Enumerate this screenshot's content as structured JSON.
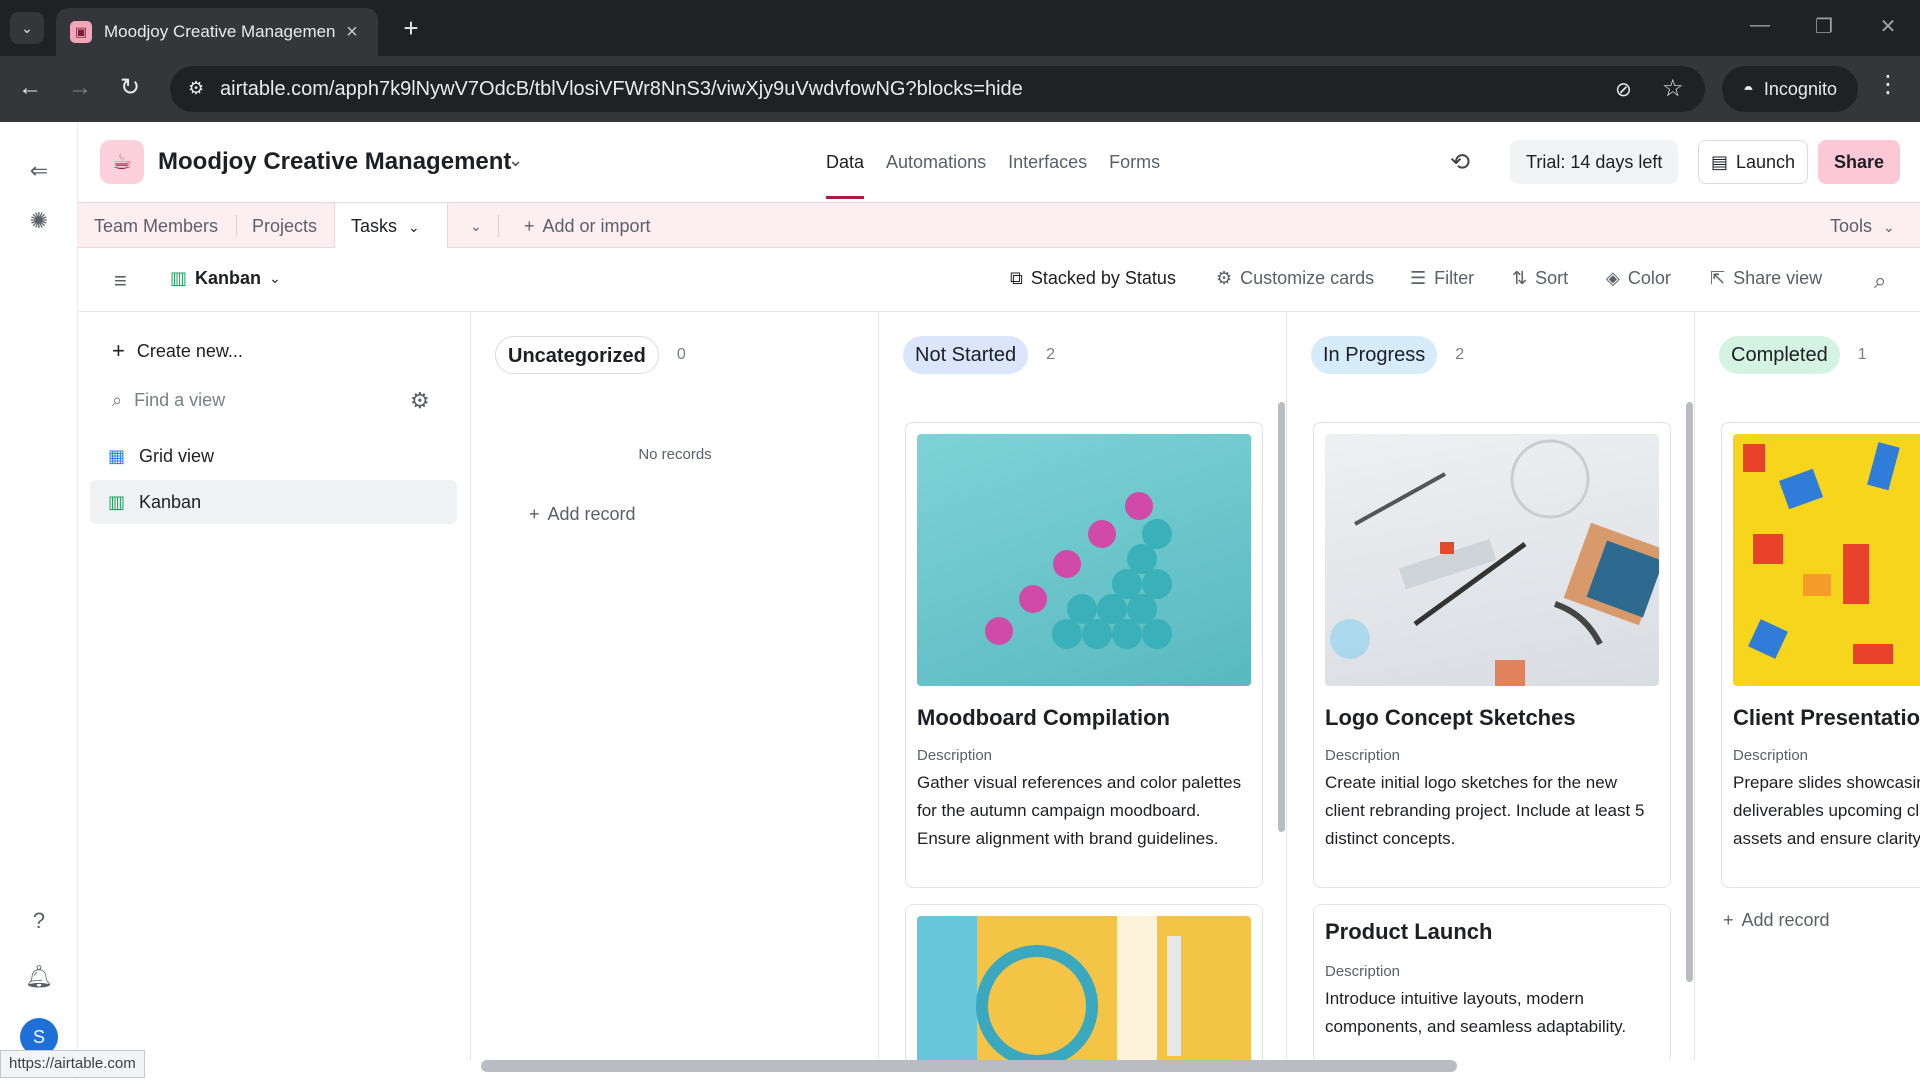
{
  "browser": {
    "tab_title": "Moodjoy Creative Managemen",
    "url": "airtable.com/apph7k9lNywV7OdcB/tblVlosiVFWr8NnS3/viwXjy9uVwdvfowNG?blocks=hide",
    "incognito_label": "Incognito",
    "status_url": "https://airtable.com"
  },
  "app": {
    "base_name": "Moodjoy Creative Management",
    "nav_tabs": [
      "Data",
      "Automations",
      "Interfaces",
      "Forms"
    ],
    "trial_label": "Trial: 14 days left",
    "launch_label": "Launch",
    "share_label": "Share",
    "user_initial": "S"
  },
  "tables": {
    "items": [
      "Team Members",
      "Projects",
      "Tasks"
    ],
    "active": "Tasks",
    "add_label": "Add or import",
    "tools_label": "Tools"
  },
  "viewbar": {
    "view_name": "Kanban",
    "stacked_label": "Stacked by Status",
    "customize_label": "Customize cards",
    "filter_label": "Filter",
    "sort_label": "Sort",
    "color_label": "Color",
    "share_view_label": "Share view"
  },
  "sidebar": {
    "create_label": "Create new...",
    "find_placeholder": "Find a view",
    "views": [
      "Grid view",
      "Kanban"
    ]
  },
  "board": {
    "description_label": "Description",
    "add_record_label": "Add record",
    "no_records_label": "No records",
    "columns": [
      {
        "name": "Uncategorized",
        "count": "0",
        "color": "#ffffff"
      },
      {
        "name": "Not Started",
        "count": "2",
        "color": "#dbe5fb"
      },
      {
        "name": "In Progress",
        "count": "2",
        "color": "#d6ecfb"
      },
      {
        "name": "Completed",
        "count": "1",
        "color": "#d4f3e2"
      }
    ],
    "cards": {
      "not_started_1": {
        "title": "Moodboard Compilation",
        "description": "Gather visual references and color palettes for the autumn campaign moodboard. Ensure alignment with brand guidelines."
      },
      "in_progress_1": {
        "title": "Logo Concept Sketches",
        "description": "Create initial logo sketches for the new client rebranding project. Include at least 5 distinct concepts."
      },
      "in_progress_2": {
        "title": "Product Launch",
        "description": "Introduce intuitive layouts, modern components, and seamless adaptability."
      },
      "completed_1": {
        "title": "Client Presentation",
        "description": "Prepare slides showcasing milestones and deliverables upcoming client meeting assets and ensure clarity"
      }
    }
  }
}
